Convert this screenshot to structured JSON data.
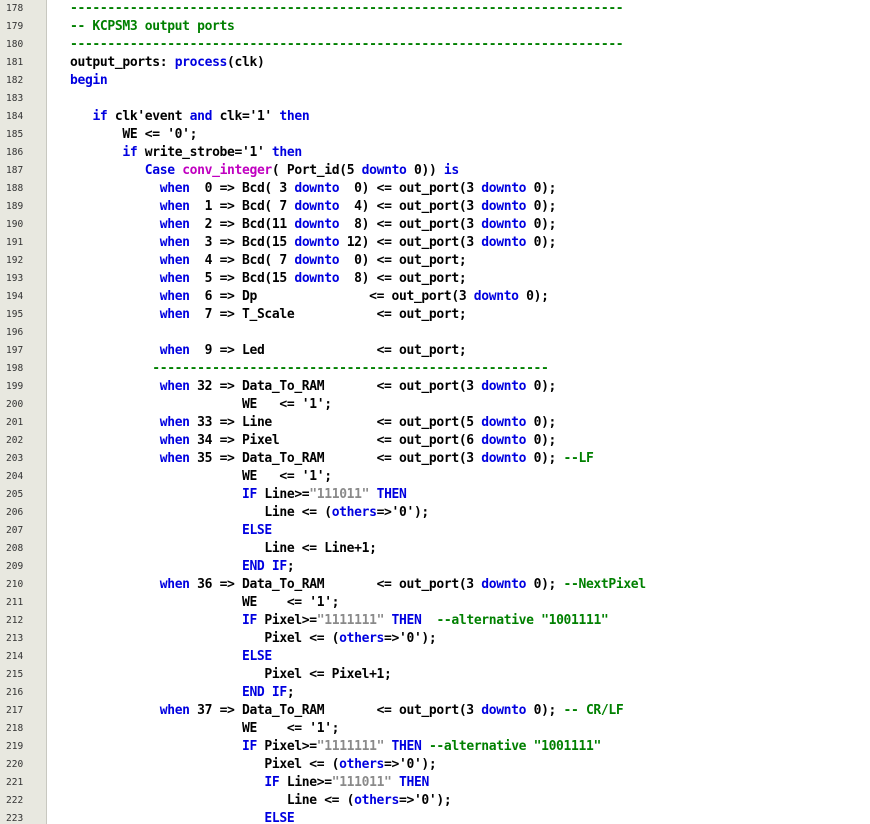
{
  "colors": {
    "keyword": "#0000e0",
    "function": "#c000c0",
    "string": "#8a8a8a",
    "comment": "#008000",
    "text": "#000000",
    "gutter": "#e8e8e0"
  },
  "lines": [
    {
      "n": "178",
      "tokens": [
        {
          "t": "cm",
          "v": "--------------------------------------------------------------------------"
        }
      ]
    },
    {
      "n": "179",
      "tokens": [
        {
          "t": "cm",
          "v": "-- KCPSM3 output ports"
        }
      ]
    },
    {
      "n": "180",
      "tokens": [
        {
          "t": "cm",
          "v": "--------------------------------------------------------------------------"
        }
      ]
    },
    {
      "n": "181",
      "tokens": [
        {
          "t": "tx",
          "v": "output_ports: "
        },
        {
          "t": "kw",
          "v": "process"
        },
        {
          "t": "tx",
          "v": "(clk)"
        }
      ]
    },
    {
      "n": "182",
      "tokens": [
        {
          "t": "kw",
          "v": "begin"
        }
      ]
    },
    {
      "n": "183",
      "tokens": []
    },
    {
      "n": "184",
      "tokens": [
        {
          "t": "tx",
          "v": "   "
        },
        {
          "t": "kw",
          "v": "if"
        },
        {
          "t": "tx",
          "v": " clk'event "
        },
        {
          "t": "kw",
          "v": "and"
        },
        {
          "t": "tx",
          "v": " clk='1' "
        },
        {
          "t": "kw",
          "v": "then"
        }
      ]
    },
    {
      "n": "185",
      "tokens": [
        {
          "t": "tx",
          "v": "       WE <= '0';"
        }
      ]
    },
    {
      "n": "186",
      "tokens": [
        {
          "t": "tx",
          "v": "       "
        },
        {
          "t": "kw",
          "v": "if"
        },
        {
          "t": "tx",
          "v": " write_strobe='1' "
        },
        {
          "t": "kw",
          "v": "then"
        }
      ]
    },
    {
      "n": "187",
      "tokens": [
        {
          "t": "tx",
          "v": "          "
        },
        {
          "t": "kw",
          "v": "Case"
        },
        {
          "t": "tx",
          "v": " "
        },
        {
          "t": "fn",
          "v": "conv_integer"
        },
        {
          "t": "tx",
          "v": "( Port_id(5 "
        },
        {
          "t": "kw",
          "v": "downto"
        },
        {
          "t": "tx",
          "v": " 0)) "
        },
        {
          "t": "kw",
          "v": "is"
        }
      ]
    },
    {
      "n": "188",
      "tokens": [
        {
          "t": "tx",
          "v": "            "
        },
        {
          "t": "kw",
          "v": "when"
        },
        {
          "t": "tx",
          "v": "  0 => Bcd( 3 "
        },
        {
          "t": "kw",
          "v": "downto"
        },
        {
          "t": "tx",
          "v": "  0) <= out_port(3 "
        },
        {
          "t": "kw",
          "v": "downto"
        },
        {
          "t": "tx",
          "v": " 0);"
        }
      ]
    },
    {
      "n": "189",
      "tokens": [
        {
          "t": "tx",
          "v": "            "
        },
        {
          "t": "kw",
          "v": "when"
        },
        {
          "t": "tx",
          "v": "  1 => Bcd( 7 "
        },
        {
          "t": "kw",
          "v": "downto"
        },
        {
          "t": "tx",
          "v": "  4) <= out_port(3 "
        },
        {
          "t": "kw",
          "v": "downto"
        },
        {
          "t": "tx",
          "v": " 0);"
        }
      ]
    },
    {
      "n": "190",
      "tokens": [
        {
          "t": "tx",
          "v": "            "
        },
        {
          "t": "kw",
          "v": "when"
        },
        {
          "t": "tx",
          "v": "  2 => Bcd(11 "
        },
        {
          "t": "kw",
          "v": "downto"
        },
        {
          "t": "tx",
          "v": "  8) <= out_port(3 "
        },
        {
          "t": "kw",
          "v": "downto"
        },
        {
          "t": "tx",
          "v": " 0);"
        }
      ]
    },
    {
      "n": "191",
      "tokens": [
        {
          "t": "tx",
          "v": "            "
        },
        {
          "t": "kw",
          "v": "when"
        },
        {
          "t": "tx",
          "v": "  3 => Bcd(15 "
        },
        {
          "t": "kw",
          "v": "downto"
        },
        {
          "t": "tx",
          "v": " 12) <= out_port(3 "
        },
        {
          "t": "kw",
          "v": "downto"
        },
        {
          "t": "tx",
          "v": " 0);"
        }
      ]
    },
    {
      "n": "192",
      "tokens": [
        {
          "t": "tx",
          "v": "            "
        },
        {
          "t": "kw",
          "v": "when"
        },
        {
          "t": "tx",
          "v": "  4 => Bcd( 7 "
        },
        {
          "t": "kw",
          "v": "downto"
        },
        {
          "t": "tx",
          "v": "  0) <= out_port;"
        }
      ]
    },
    {
      "n": "193",
      "tokens": [
        {
          "t": "tx",
          "v": "            "
        },
        {
          "t": "kw",
          "v": "when"
        },
        {
          "t": "tx",
          "v": "  5 => Bcd(15 "
        },
        {
          "t": "kw",
          "v": "downto"
        },
        {
          "t": "tx",
          "v": "  8) <= out_port;"
        }
      ]
    },
    {
      "n": "194",
      "tokens": [
        {
          "t": "tx",
          "v": "            "
        },
        {
          "t": "kw",
          "v": "when"
        },
        {
          "t": "tx",
          "v": "  6 => Dp               <= out_port(3 "
        },
        {
          "t": "kw",
          "v": "downto"
        },
        {
          "t": "tx",
          "v": " 0);"
        }
      ]
    },
    {
      "n": "195",
      "tokens": [
        {
          "t": "tx",
          "v": "            "
        },
        {
          "t": "kw",
          "v": "when"
        },
        {
          "t": "tx",
          "v": "  7 => T_Scale           <= out_port;"
        }
      ]
    },
    {
      "n": "196",
      "tokens": []
    },
    {
      "n": "197",
      "tokens": [
        {
          "t": "tx",
          "v": "            "
        },
        {
          "t": "kw",
          "v": "when"
        },
        {
          "t": "tx",
          "v": "  9 => Led               <= out_port;"
        }
      ]
    },
    {
      "n": "198",
      "tokens": [
        {
          "t": "tx",
          "v": "           "
        },
        {
          "t": "cm",
          "v": "-----------------------------------------------------"
        }
      ]
    },
    {
      "n": "199",
      "tokens": [
        {
          "t": "tx",
          "v": "            "
        },
        {
          "t": "kw",
          "v": "when"
        },
        {
          "t": "tx",
          "v": " 32 => Data_To_RAM       <= out_port(3 "
        },
        {
          "t": "kw",
          "v": "downto"
        },
        {
          "t": "tx",
          "v": " 0);"
        }
      ]
    },
    {
      "n": "200",
      "tokens": [
        {
          "t": "tx",
          "v": "                       WE   <= '1';"
        }
      ]
    },
    {
      "n": "201",
      "tokens": [
        {
          "t": "tx",
          "v": "            "
        },
        {
          "t": "kw",
          "v": "when"
        },
        {
          "t": "tx",
          "v": " 33 => Line              <= out_port(5 "
        },
        {
          "t": "kw",
          "v": "downto"
        },
        {
          "t": "tx",
          "v": " 0);"
        }
      ]
    },
    {
      "n": "202",
      "tokens": [
        {
          "t": "tx",
          "v": "            "
        },
        {
          "t": "kw",
          "v": "when"
        },
        {
          "t": "tx",
          "v": " 34 => Pixel             <= out_port(6 "
        },
        {
          "t": "kw",
          "v": "downto"
        },
        {
          "t": "tx",
          "v": " 0);"
        }
      ]
    },
    {
      "n": "203",
      "tokens": [
        {
          "t": "tx",
          "v": "            "
        },
        {
          "t": "kw",
          "v": "when"
        },
        {
          "t": "tx",
          "v": " 35 => Data_To_RAM       <= out_port(3 "
        },
        {
          "t": "kw",
          "v": "downto"
        },
        {
          "t": "tx",
          "v": " 0); "
        },
        {
          "t": "cm",
          "v": "--LF"
        }
      ]
    },
    {
      "n": "204",
      "tokens": [
        {
          "t": "tx",
          "v": "                       WE   <= '1';"
        }
      ]
    },
    {
      "n": "205",
      "tokens": [
        {
          "t": "tx",
          "v": "                       "
        },
        {
          "t": "kw",
          "v": "IF"
        },
        {
          "t": "tx",
          "v": " Line>="
        },
        {
          "t": "str",
          "v": "\"111011\""
        },
        {
          "t": "tx",
          "v": " "
        },
        {
          "t": "kw",
          "v": "THEN"
        }
      ]
    },
    {
      "n": "206",
      "tokens": [
        {
          "t": "tx",
          "v": "                          Line <= ("
        },
        {
          "t": "kw",
          "v": "others"
        },
        {
          "t": "tx",
          "v": "=>'0');"
        }
      ]
    },
    {
      "n": "207",
      "tokens": [
        {
          "t": "tx",
          "v": "                       "
        },
        {
          "t": "kw",
          "v": "ELSE"
        }
      ]
    },
    {
      "n": "208",
      "tokens": [
        {
          "t": "tx",
          "v": "                          Line <= Line+1;"
        }
      ]
    },
    {
      "n": "209",
      "tokens": [
        {
          "t": "tx",
          "v": "                       "
        },
        {
          "t": "kw",
          "v": "END IF"
        },
        {
          "t": "tx",
          "v": ";"
        }
      ]
    },
    {
      "n": "210",
      "tokens": [
        {
          "t": "tx",
          "v": "            "
        },
        {
          "t": "kw",
          "v": "when"
        },
        {
          "t": "tx",
          "v": " 36 => Data_To_RAM       <= out_port(3 "
        },
        {
          "t": "kw",
          "v": "downto"
        },
        {
          "t": "tx",
          "v": " 0); "
        },
        {
          "t": "cm",
          "v": "--NextPixel"
        }
      ]
    },
    {
      "n": "211",
      "tokens": [
        {
          "t": "tx",
          "v": "                       WE    <= '1';"
        }
      ]
    },
    {
      "n": "212",
      "tokens": [
        {
          "t": "tx",
          "v": "                       "
        },
        {
          "t": "kw",
          "v": "IF"
        },
        {
          "t": "tx",
          "v": " Pixel>="
        },
        {
          "t": "str",
          "v": "\"1111111\""
        },
        {
          "t": "tx",
          "v": " "
        },
        {
          "t": "kw",
          "v": "THEN"
        },
        {
          "t": "tx",
          "v": "  "
        },
        {
          "t": "cm",
          "v": "--alternative \"1001111\""
        }
      ]
    },
    {
      "n": "213",
      "tokens": [
        {
          "t": "tx",
          "v": "                          Pixel <= ("
        },
        {
          "t": "kw",
          "v": "others"
        },
        {
          "t": "tx",
          "v": "=>'0');"
        }
      ]
    },
    {
      "n": "214",
      "tokens": [
        {
          "t": "tx",
          "v": "                       "
        },
        {
          "t": "kw",
          "v": "ELSE"
        }
      ]
    },
    {
      "n": "215",
      "tokens": [
        {
          "t": "tx",
          "v": "                          Pixel <= Pixel+1;"
        }
      ]
    },
    {
      "n": "216",
      "tokens": [
        {
          "t": "tx",
          "v": "                       "
        },
        {
          "t": "kw",
          "v": "END IF"
        },
        {
          "t": "tx",
          "v": ";"
        }
      ]
    },
    {
      "n": "217",
      "tokens": [
        {
          "t": "tx",
          "v": "            "
        },
        {
          "t": "kw",
          "v": "when"
        },
        {
          "t": "tx",
          "v": " 37 => Data_To_RAM       <= out_port(3 "
        },
        {
          "t": "kw",
          "v": "downto"
        },
        {
          "t": "tx",
          "v": " 0); "
        },
        {
          "t": "cm",
          "v": "-- CR/LF"
        }
      ]
    },
    {
      "n": "218",
      "tokens": [
        {
          "t": "tx",
          "v": "                       WE    <= '1';"
        }
      ]
    },
    {
      "n": "219",
      "tokens": [
        {
          "t": "tx",
          "v": "                       "
        },
        {
          "t": "kw",
          "v": "IF"
        },
        {
          "t": "tx",
          "v": " Pixel>="
        },
        {
          "t": "str",
          "v": "\"1111111\""
        },
        {
          "t": "tx",
          "v": " "
        },
        {
          "t": "kw",
          "v": "THEN"
        },
        {
          "t": "tx",
          "v": " "
        },
        {
          "t": "cm",
          "v": "--alternative \"1001111\""
        }
      ]
    },
    {
      "n": "220",
      "tokens": [
        {
          "t": "tx",
          "v": "                          Pixel <= ("
        },
        {
          "t": "kw",
          "v": "others"
        },
        {
          "t": "tx",
          "v": "=>'0');"
        }
      ]
    },
    {
      "n": "221",
      "tokens": [
        {
          "t": "tx",
          "v": "                          "
        },
        {
          "t": "kw",
          "v": "IF"
        },
        {
          "t": "tx",
          "v": " Line>="
        },
        {
          "t": "str",
          "v": "\"111011\""
        },
        {
          "t": "tx",
          "v": " "
        },
        {
          "t": "kw",
          "v": "THEN"
        }
      ]
    },
    {
      "n": "222",
      "tokens": [
        {
          "t": "tx",
          "v": "                             Line <= ("
        },
        {
          "t": "kw",
          "v": "others"
        },
        {
          "t": "tx",
          "v": "=>'0');"
        }
      ]
    },
    {
      "n": "223",
      "tokens": [
        {
          "t": "tx",
          "v": "                          "
        },
        {
          "t": "kw",
          "v": "ELSE"
        }
      ]
    }
  ]
}
